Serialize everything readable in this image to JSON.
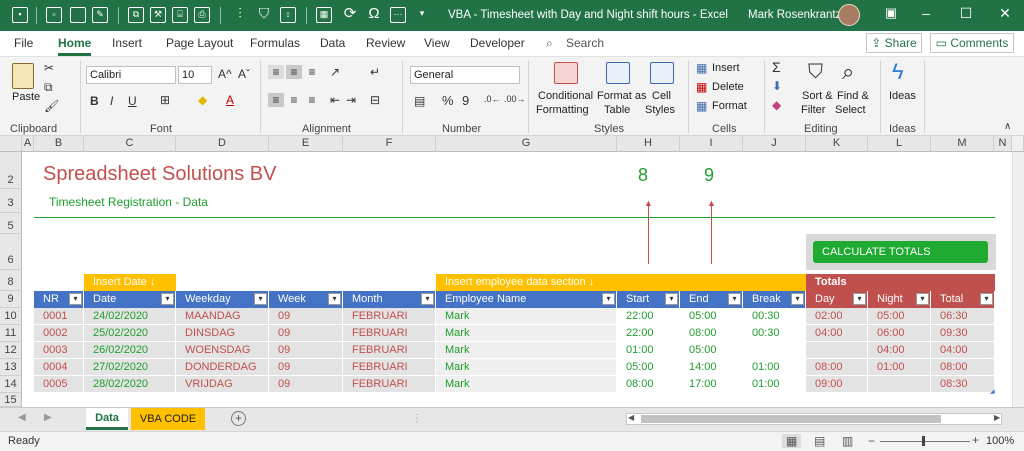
{
  "window": {
    "title": "VBA - Timesheet with Day and Night shift hours  -  Excel",
    "user": "Mark Rosenkrantz",
    "controls": [
      "minimize",
      "restore",
      "close"
    ]
  },
  "menu": {
    "tabs": [
      "File",
      "Home",
      "Insert",
      "Page Layout",
      "Formulas",
      "Data",
      "Review",
      "View",
      "Developer"
    ],
    "active": "Home",
    "search": "Search",
    "share": "Share",
    "comments": "Comments"
  },
  "ribbon": {
    "clipboard": {
      "paste": "Paste",
      "label": "Clipboard"
    },
    "font": {
      "name": "Calibri",
      "size": "10",
      "label": "Font",
      "bold": "B",
      "italic": "I",
      "underline": "U",
      "grow": "A^",
      "shrink": "Aˇ"
    },
    "alignment": {
      "label": "Alignment"
    },
    "number": {
      "format": "General",
      "label": "Number",
      "pct": "%",
      "comma": "9"
    },
    "styles": {
      "cond": [
        "Conditional",
        "Formatting"
      ],
      "table": [
        "Format as",
        "Table"
      ],
      "cell": [
        "Cell",
        "Styles"
      ],
      "label": "Styles"
    },
    "cells": {
      "insert": "Insert",
      "delete": "Delete",
      "format": "Format",
      "label": "Cells"
    },
    "editing": {
      "sort": [
        "Sort &",
        "Filter"
      ],
      "find": [
        "Find &",
        "Select"
      ],
      "label": "Editing",
      "sum": "Σ"
    },
    "ideas": {
      "btn": "Ideas",
      "label": "Ideas"
    }
  },
  "columns": [
    "A",
    "B",
    "C",
    "D",
    "E",
    "F",
    "G",
    "H",
    "I",
    "J",
    "K",
    "L",
    "M",
    "N"
  ],
  "rows": [
    "2",
    "3",
    "5",
    "6",
    "8",
    "9",
    "10",
    "11",
    "12",
    "13",
    "14",
    "15"
  ],
  "sheet": {
    "company": "Spreadsheet Solutions BV",
    "subtitle": "Timesheet Registration - Data",
    "col_h_value": "8",
    "col_i_value": "9",
    "button": "CALCULATE TOTALS",
    "section_date": "Insert Date ↓",
    "section_employee": "Insert employee data section ↓",
    "section_totals": "Totals",
    "headers": [
      "NR",
      "Date",
      "Weekday",
      "Week",
      "Month",
      "Employee Name",
      "Start",
      "End",
      "Break",
      "Day",
      "Night",
      "Total"
    ],
    "data": [
      [
        "0001",
        "24/02/2020",
        "MAANDAG",
        "09",
        "FEBRUARI",
        "Mark",
        "22:00",
        "05:00",
        "00:30",
        "02:00",
        "05:00",
        "06:30"
      ],
      [
        "0002",
        "25/02/2020",
        "DINSDAG",
        "09",
        "FEBRUARI",
        "Mark",
        "22:00",
        "08:00",
        "00:30",
        "04:00",
        "06:00",
        "09:30"
      ],
      [
        "0003",
        "26/02/2020",
        "WOENSDAG",
        "09",
        "FEBRUARI",
        "Mark",
        "01:00",
        "05:00",
        "",
        "",
        "04:00",
        "04:00"
      ],
      [
        "0004",
        "27/02/2020",
        "DONDERDAG",
        "09",
        "FEBRUARI",
        "Mark",
        "05:00",
        "14:00",
        "01:00",
        "08:00",
        "01:00",
        "08:00"
      ],
      [
        "0005",
        "28/02/2020",
        "VRIJDAG",
        "09",
        "FEBRUARI",
        "Mark",
        "08:00",
        "17:00",
        "01:00",
        "09:00",
        "",
        "08:30"
      ]
    ]
  },
  "sheet_tabs": [
    "Data",
    "VBA CODE"
  ],
  "status": {
    "left": "Ready",
    "zoom": "100%",
    "minus": "−",
    "plus": "+"
  },
  "colors": {
    "excel_green": "#217346",
    "header_blue": "#4472c4",
    "yellow": "#ffc000",
    "totals_red": "#c0504d",
    "text_green": "#1f9e2e",
    "text_red": "#c0504d"
  }
}
